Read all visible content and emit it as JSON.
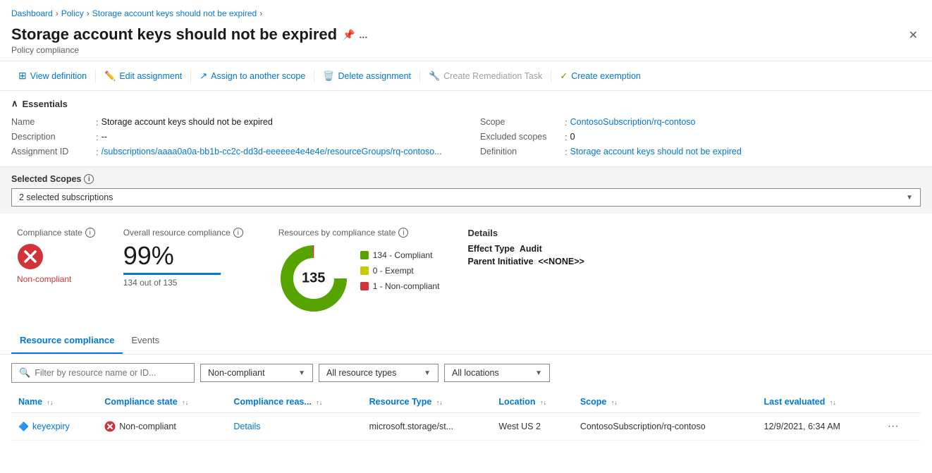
{
  "breadcrumb": {
    "items": [
      "Dashboard",
      "Policy",
      "Storage account keys should not be expired"
    ]
  },
  "header": {
    "title": "Storage account keys should not be expired",
    "subtitle": "Policy compliance",
    "pin_icon": "📌",
    "more_icon": "...",
    "close_icon": "✕"
  },
  "toolbar": {
    "view_definition": "View definition",
    "edit_assignment": "Edit assignment",
    "assign_to_scope": "Assign to another scope",
    "delete_assignment": "Delete assignment",
    "create_remediation": "Create Remediation Task",
    "create_exemption": "Create exemption"
  },
  "essentials": {
    "section_label": "Essentials",
    "name_label": "Name",
    "name_value": "Storage account keys should not be expired",
    "description_label": "Description",
    "description_value": "--",
    "assignment_id_label": "Assignment ID",
    "assignment_id_value": "/subscriptions/aaaa0a0a-bb1b-cc2c-dd3d-eeeeee4e4e4e/resourceGroups/rq-contoso...",
    "scope_label": "Scope",
    "scope_value": "ContosoSubscription/rq-contoso",
    "excluded_scopes_label": "Excluded scopes",
    "excluded_scopes_value": "0",
    "definition_label": "Definition",
    "definition_value": "Storage account keys should not be expired"
  },
  "selected_scopes": {
    "label": "Selected Scopes",
    "dropdown_value": "2 selected subscriptions"
  },
  "metrics": {
    "compliance_state_label": "Compliance state",
    "compliance_state_value": "Non-compliant",
    "overall_label": "Overall resource compliance",
    "overall_percent": "99%",
    "overall_sub": "134 out of 135",
    "bar_fill_percent": 99,
    "resources_label": "Resources by compliance state",
    "total_resources": "135",
    "legend": [
      {
        "label": "134 - Compliant",
        "color": "#57a300"
      },
      {
        "label": "0 - Exempt",
        "color": "#c8c800"
      },
      {
        "label": "1 - Non-compliant",
        "color": "#d13438"
      }
    ],
    "details_title": "Details",
    "effect_type_label": "Effect Type",
    "effect_type_value": "Audit",
    "parent_initiative_label": "Parent Initiative",
    "parent_initiative_value": "<<NONE>>"
  },
  "tabs": [
    {
      "label": "Resource compliance",
      "active": true
    },
    {
      "label": "Events",
      "active": false
    }
  ],
  "filters": {
    "search_placeholder": "Filter by resource name or ID...",
    "compliance_filter": "Non-compliant",
    "resource_type_filter": "All resource types",
    "location_filter": "All locations"
  },
  "table": {
    "columns": [
      {
        "label": "Name",
        "sortable": true
      },
      {
        "label": "Compliance state",
        "sortable": true
      },
      {
        "label": "Compliance reas...",
        "sortable": true
      },
      {
        "label": "Resource Type",
        "sortable": true
      },
      {
        "label": "Location",
        "sortable": true
      },
      {
        "label": "Scope",
        "sortable": true
      },
      {
        "label": "Last evaluated",
        "sortable": true
      }
    ],
    "rows": [
      {
        "name": "keyexpiry",
        "name_icon": "🔷",
        "compliance_state": "Non-compliant",
        "compliance_reason": "Details",
        "resource_type": "microsoft.storage/st...",
        "location": "West US 2",
        "scope": "ContosoSubscription/rq-contoso",
        "last_evaluated": "12/9/2021, 6:34 AM"
      }
    ]
  }
}
